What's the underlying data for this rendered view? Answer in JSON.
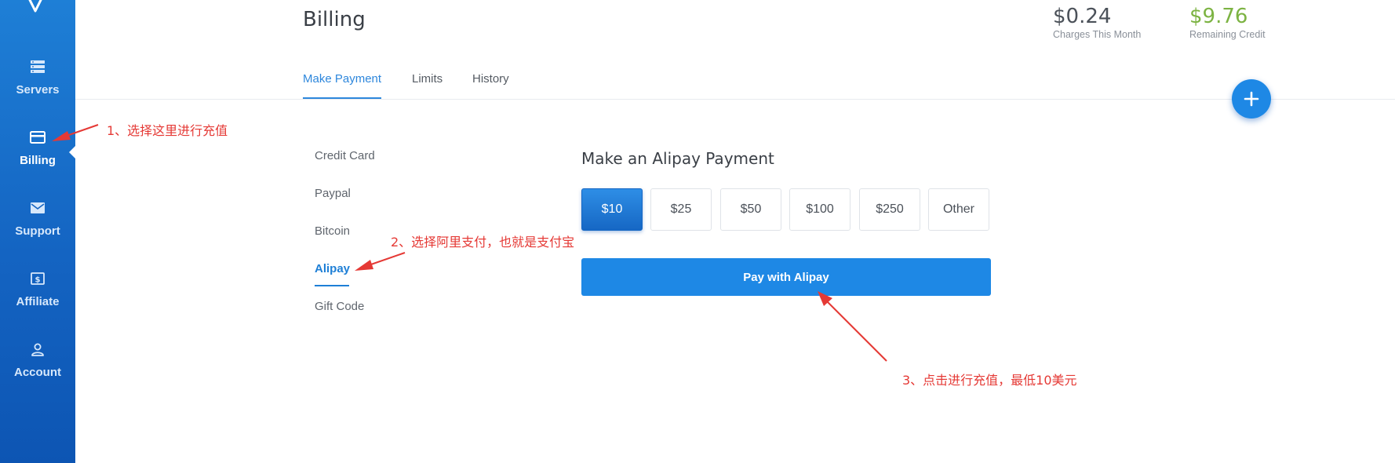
{
  "sidebar": {
    "items": [
      {
        "label": "Servers",
        "icon": "servers-icon"
      },
      {
        "label": "Billing",
        "icon": "card-icon"
      },
      {
        "label": "Support",
        "icon": "mail-icon"
      },
      {
        "label": "Affiliate",
        "icon": "dollar-icon"
      },
      {
        "label": "Account",
        "icon": "user-icon"
      }
    ],
    "active": "Billing"
  },
  "header": {
    "title": "Billing",
    "stats": [
      {
        "value": "$0.24",
        "label": "Charges This Month"
      },
      {
        "value": "$9.76",
        "label": "Remaining Credit",
        "color": "#7cb342"
      }
    ]
  },
  "tabs": [
    {
      "label": "Make Payment"
    },
    {
      "label": "Limits"
    },
    {
      "label": "History"
    }
  ],
  "methods": [
    {
      "label": "Credit Card"
    },
    {
      "label": "Paypal"
    },
    {
      "label": "Bitcoin"
    },
    {
      "label": "Alipay"
    },
    {
      "label": "Gift Code"
    }
  ],
  "payment": {
    "title": "Make an Alipay Payment",
    "amounts": [
      "$10",
      "$25",
      "$50",
      "$100",
      "$250",
      "Other"
    ],
    "selected_amount": "$10",
    "button_label": "Pay with Alipay"
  },
  "annotations": {
    "step1": "1、选择这里进行充值",
    "step2": "2、选择阿里支付，也就是支付宝",
    "step3": "3、点击进行充值，最低10美元"
  },
  "colors": {
    "accent": "#1e88e5",
    "sidebar": "#1464c2",
    "credit": "#7cb342",
    "annotation": "#e53935"
  }
}
